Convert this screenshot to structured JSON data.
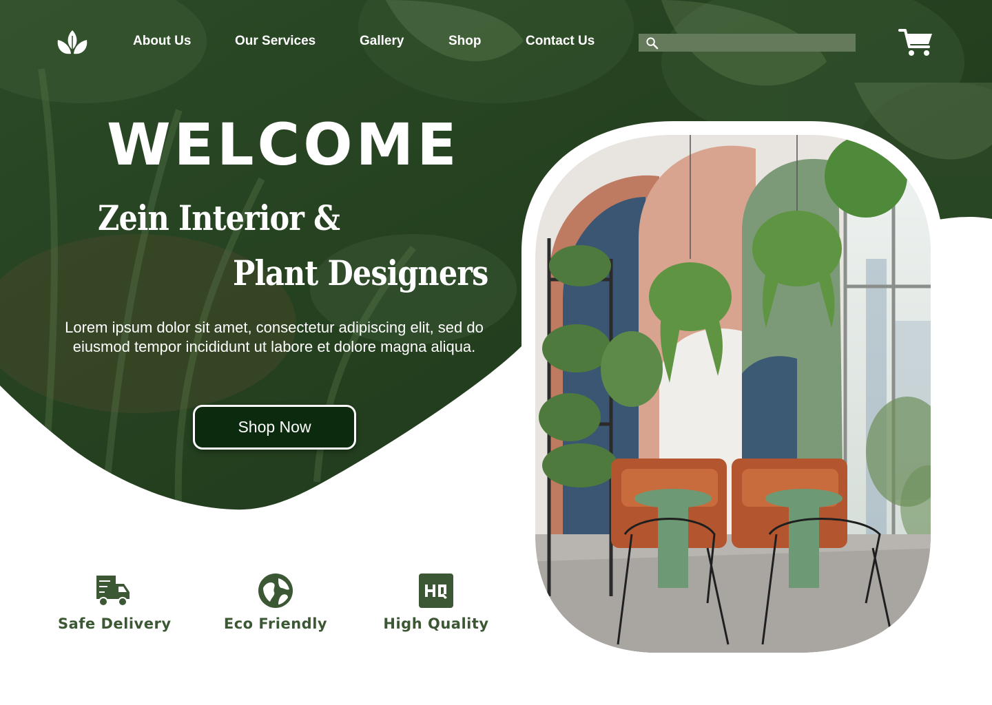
{
  "nav": {
    "links": [
      "About Us",
      "Our Services",
      "Gallery",
      "Shop",
      "Contact Us"
    ],
    "search_placeholder": ""
  },
  "hero": {
    "welcome": "WELCOME",
    "tagline_line1": "Zein Interior &",
    "tagline_line2": "Plant Designers",
    "description": "Lorem ipsum dolor sit amet, consectetur adipiscing elit, sed do eiusmod tempor incididunt ut labore et dolore magna aliqua.",
    "cta": "Shop Now"
  },
  "features": [
    {
      "label": "Safe Delivery",
      "icon": "delivery-truck-icon"
    },
    {
      "label": "Eco Friendly",
      "icon": "globe-icon"
    },
    {
      "label": "High Quality",
      "icon": "hq-badge-icon"
    }
  ],
  "icons": {
    "logo": "leaf-logo-icon",
    "search": "search-icon",
    "cart": "shopping-cart-icon"
  },
  "colors": {
    "hero_green": "#1f3a1c",
    "search_bg": "#657a5a",
    "button_bg": "#0c2b0e",
    "feature_green": "#3b5733",
    "text_white": "#ffffff"
  }
}
